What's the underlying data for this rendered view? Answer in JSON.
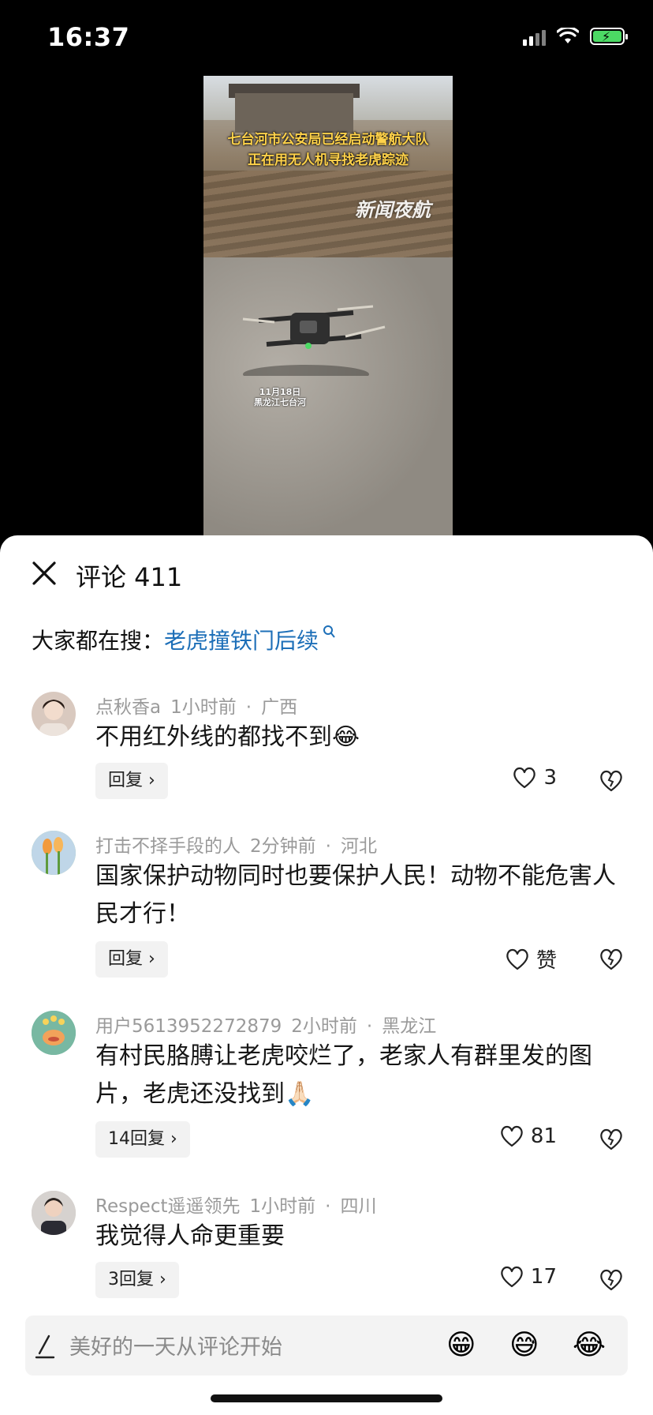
{
  "status_bar": {
    "time": "16:37"
  },
  "video": {
    "overlay_line1": "七台河市公安局已经启动警航大队",
    "overlay_line2": "正在用无人机寻找老虎踪迹",
    "watermark": "新闻夜航",
    "date_line1": "11月18日",
    "date_line2": "黑龙江七台河"
  },
  "sheet": {
    "title": "评论 411",
    "trending_prefix": "大家都在搜：",
    "trending_link": "老虎撞铁门后续"
  },
  "comments": [
    {
      "user": "点秋香a",
      "time": "1小时前",
      "location": "广西",
      "text": "不用红外线的都找不到😂",
      "reply": "回复 ›",
      "likes": "3",
      "avatar_color": "#d9c9bf"
    },
    {
      "user": "打击不择手段的人",
      "time": "2分钟前",
      "location": "河北",
      "text": "国家保护动物同时也要保护人民！动物不能危害人民才行！",
      "reply": "回复 ›",
      "likes": "赞",
      "avatar_color": "#a9c98a"
    },
    {
      "user": "用户5613952272879",
      "time": "2小时前",
      "location": "黑龙江",
      "text": "有村民胳膊让老虎咬烂了，老家人有群里发的图片，老虎还没找到🙏🏻",
      "reply": "14回复 ›",
      "likes": "81",
      "avatar_color": "#79b7a4"
    },
    {
      "user": "Respect遥遥领先",
      "time": "1小时前",
      "location": "四川",
      "text": "我觉得人命更重要",
      "reply": "3回复 ›",
      "likes": "17",
      "avatar_color": "#c6c1bd"
    }
  ],
  "input_bar": {
    "placeholder": "美好的一天从评论开始",
    "emojis": [
      "😁",
      "😅",
      "😂"
    ]
  }
}
